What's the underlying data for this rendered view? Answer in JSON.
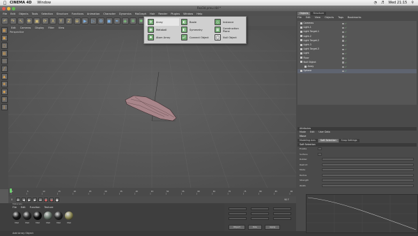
{
  "mac_menubar": {
    "app_name": "CINEMA 4D",
    "menu": "Window",
    "clock": "Wed 21:15"
  },
  "window": {
    "title": "Rez3d.prev.c4d *"
  },
  "menubar": {
    "items": [
      "File",
      "Edit",
      "Objects",
      "Tools",
      "Selection",
      "Structure",
      "Functions",
      "Animation",
      "Character",
      "Dynamics",
      "MoGraph",
      "Hair",
      "Render",
      "Plugins",
      "Window",
      "Help"
    ]
  },
  "viewport": {
    "menu": [
      "Edit",
      "Cameras",
      "Display",
      "Filter",
      "View"
    ],
    "label": "Perspective"
  },
  "dropdown": {
    "columns": [
      [
        "Array",
        "Metaball",
        "Atom Array"
      ],
      [
        "Boole",
        "Symmetry",
        "Connect Object"
      ],
      [
        "Instance",
        "Construction Plane",
        "Null Object"
      ]
    ],
    "icons": [
      [
        "array-icon",
        "metaball-icon",
        "atom-array-icon"
      ],
      [
        "boole-icon",
        "symmetry-icon",
        "connect-object-icon"
      ],
      [
        "instance-icon",
        "construction-plane-icon",
        "null-object-icon"
      ]
    ],
    "selected": "Array"
  },
  "timeline": {
    "frame_start": "0",
    "frame_end": "90 F",
    "ticks": [
      "0",
      "5",
      "10",
      "15",
      "20",
      "25",
      "30",
      "35",
      "40",
      "45",
      "50",
      "55",
      "60",
      "65",
      "70",
      "75",
      "80",
      "85",
      "90"
    ]
  },
  "materials": {
    "panel_title": "Materials",
    "menu": [
      "File",
      "Edit",
      "Function",
      "Texture"
    ],
    "items": [
      {
        "label": "Mat",
        "color": "#1a1a1a"
      },
      {
        "label": "Mat",
        "color": "#2a2a2a"
      },
      {
        "label": "Mat",
        "color": "#0e0e0e"
      },
      {
        "label": "Mat",
        "color": "#6d7a70"
      },
      {
        "label": "Mat",
        "color": "#2b2b2b"
      },
      {
        "label": "Mat",
        "color": "#8e8a56"
      }
    ]
  },
  "coordinates": {
    "apply_label": "Apply",
    "object_label": "Object",
    "size_label": "Size"
  },
  "statusbar": {
    "text": "Add Array Object"
  },
  "objects_panel": {
    "tabs": [
      "Objects",
      "Structure"
    ],
    "menu": [
      "File",
      "Edit",
      "View",
      "Objects",
      "Tags",
      "Bookmarks"
    ],
    "rows": [
      "Cameras",
      "Light.1",
      "Light Target.1",
      "Light.2",
      "Light Target.2",
      "Light.3",
      "Light Target.3",
      "Light",
      "Floor",
      "Null Object",
      "Array",
      "Sphere"
    ]
  },
  "attributes": {
    "header": "Attributes",
    "menu": [
      "Mode",
      "Edit",
      "User Data"
    ],
    "title": "Move",
    "tabs": [
      "Modeling Axis",
      "Soft Selection",
      "Snap Settings"
    ],
    "section": "Soft Selection",
    "rows": [
      "Enable",
      "Surface",
      "Rubber",
      "Restrict",
      "Mode",
      "Radius",
      "Strength",
      "Width"
    ]
  },
  "colors": {
    "viewport_bg": "#585858",
    "object_color": "#a8858a",
    "accent_green": "#7fd07f"
  }
}
